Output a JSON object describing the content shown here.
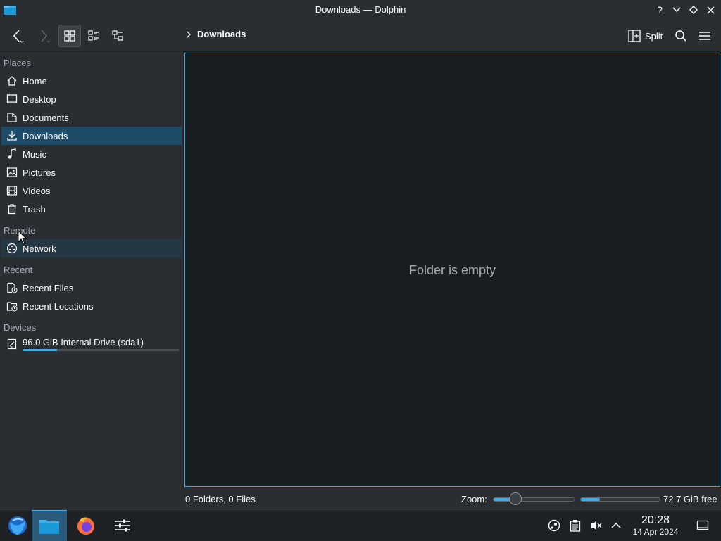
{
  "window": {
    "title": "Downloads — Dolphin"
  },
  "toolbar": {
    "breadcrumb": "Downloads",
    "split_label": "Split"
  },
  "sidebar": {
    "sections": {
      "places": "Places",
      "remote": "Remote",
      "recent": "Recent",
      "devices": "Devices"
    },
    "places": [
      {
        "label": "Home",
        "icon": "home-icon"
      },
      {
        "label": "Desktop",
        "icon": "desktop-icon"
      },
      {
        "label": "Documents",
        "icon": "documents-icon"
      },
      {
        "label": "Downloads",
        "icon": "download-icon"
      },
      {
        "label": "Music",
        "icon": "music-icon"
      },
      {
        "label": "Pictures",
        "icon": "pictures-icon"
      },
      {
        "label": "Videos",
        "icon": "videos-icon"
      },
      {
        "label": "Trash",
        "icon": "trash-icon"
      }
    ],
    "remote": [
      {
        "label": "Network",
        "icon": "network-icon"
      }
    ],
    "recent": [
      {
        "label": "Recent Files",
        "icon": "recent-files-icon"
      },
      {
        "label": "Recent Locations",
        "icon": "recent-locations-icon"
      }
    ],
    "devices": [
      {
        "label": "96.0 GiB Internal Drive (sda1)",
        "icon": "drive-icon",
        "usage_fraction": 0.22
      }
    ],
    "selected": "Downloads"
  },
  "view": {
    "empty_message": "Folder is empty"
  },
  "statusbar": {
    "summary": "0 Folders, 0 Files",
    "zoom_label": "Zoom:",
    "zoom_fraction": 0.28,
    "free_space_label": "72.7 GiB free",
    "used_fraction": 0.24
  },
  "taskbar": {
    "time": "20:28",
    "date": "14 Apr 2024"
  },
  "colors": {
    "accent": "#3daee9",
    "selection": "#1d4b68",
    "window_bg": "#2a2e32",
    "view_bg": "#1b1e20"
  }
}
